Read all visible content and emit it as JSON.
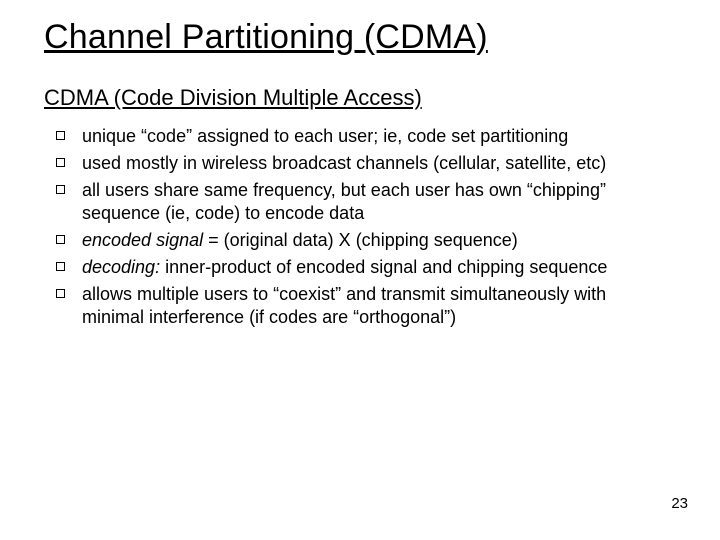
{
  "title": "Channel Partitioning (CDMA)",
  "subtitle": "CDMA (Code Division Multiple Access)",
  "bullets": [
    {
      "plain": "unique “code” assigned to each user; ie, code set partitioning"
    },
    {
      "plain": "used mostly in wireless broadcast channels (cellular, satellite, etc)"
    },
    {
      "plain": "all users share same frequency, but each user has own “chipping” sequence (ie, code) to encode data"
    },
    {
      "em": "encoded signal",
      "rest": " = (original data) X (chipping sequence)"
    },
    {
      "em": "decoding:",
      "rest": " inner-product of encoded signal and chipping sequence"
    },
    {
      "plain": "allows multiple users to “coexist” and transmit simultaneously with minimal interference (if codes are “orthogonal”)"
    }
  ],
  "page_number": "23"
}
